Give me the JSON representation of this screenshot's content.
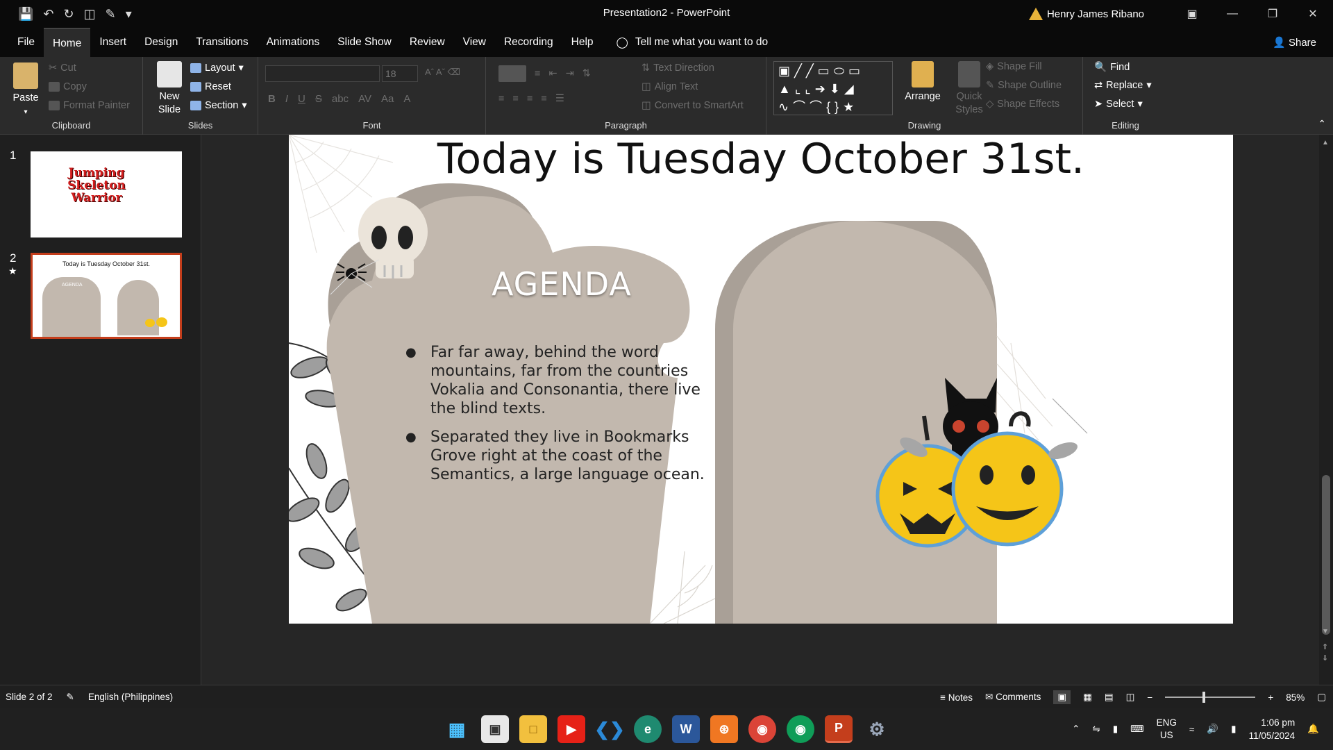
{
  "titlebar": {
    "title": "Presentation2  -  PowerPoint",
    "user": "Henry James Ribano"
  },
  "tabs": [
    "File",
    "Home",
    "Insert",
    "Design",
    "Transitions",
    "Animations",
    "Slide Show",
    "Review",
    "View",
    "Recording",
    "Help"
  ],
  "tell_me": "Tell me what you want to do",
  "share": "Share",
  "ribbon": {
    "clipboard": {
      "paste": "Paste",
      "cut": "Cut",
      "copy": "Copy",
      "format_painter": "Format Painter",
      "label": "Clipboard"
    },
    "slides": {
      "new_slide_1": "New",
      "new_slide_2": "Slide",
      "layout": "Layout",
      "reset": "Reset",
      "section": "Section",
      "label": "Slides"
    },
    "font": {
      "size": "18",
      "label": "Font"
    },
    "paragraph": {
      "text_direction": "Text Direction",
      "align_text": "Align Text",
      "convert_smartart": "Convert to SmartArt",
      "label": "Paragraph"
    },
    "drawing": {
      "arrange": "Arrange",
      "quick_styles_1": "Quick",
      "quick_styles_2": "Styles",
      "shape_fill": "Shape Fill",
      "shape_outline": "Shape Outline",
      "shape_effects": "Shape Effects",
      "label": "Drawing"
    },
    "editing": {
      "find": "Find",
      "replace": "Replace",
      "select": "Select",
      "label": "Editing"
    }
  },
  "thumbnails": [
    {
      "number": "1",
      "title": "Jumping Skeleton Warrior"
    },
    {
      "number": "2",
      "title": "Today is Tuesday October 31st.",
      "agenda": "AGENDA"
    }
  ],
  "slide": {
    "title": "Today is Tuesday October 31st.",
    "agenda_heading": "AGENDA",
    "bullets": [
      "Far far away, behind the word mountains, far from the countries Vokalia and Consonantia, there live the blind texts.",
      "Separated they live in Bookmarks Grove right at the coast of the Semantics, a large language ocean."
    ]
  },
  "statusbar": {
    "slide_info": "Slide 2 of 2",
    "language": "English (Philippines)",
    "notes": "Notes",
    "comments": "Comments",
    "zoom": "85%"
  },
  "taskbar": {
    "lang_1": "ENG",
    "lang_2": "US",
    "time": "1:06 pm",
    "date": "11/05/2024"
  },
  "colors": {
    "tombstone": "#c2b8ae",
    "tombstone_shadow": "#a9a097",
    "pumpkin": "#f5c518",
    "pumpkin_accent": "#5ea0d8",
    "accent_powerpoint": "#c43e1c"
  }
}
